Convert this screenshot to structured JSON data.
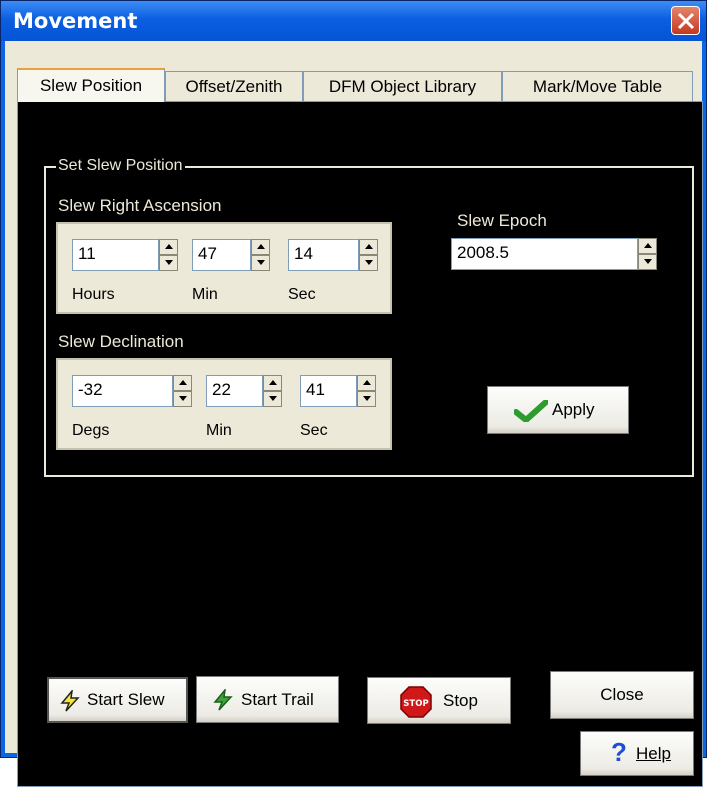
{
  "window": {
    "title": "Movement"
  },
  "tabs": [
    {
      "label": "Slew Position",
      "active": true
    },
    {
      "label": "Offset/Zenith",
      "active": false
    },
    {
      "label": "DFM Object Library",
      "active": false
    },
    {
      "label": "Mark/Move Table",
      "active": false
    }
  ],
  "slew": {
    "group_title": "Set Slew Position",
    "ra": {
      "label": "Slew Right Ascension",
      "hours": {
        "value": "11",
        "unit": "Hours"
      },
      "min": {
        "value": "47",
        "unit": "Min"
      },
      "sec": {
        "value": "14",
        "unit": "Sec"
      }
    },
    "dec": {
      "label": "Slew Declination",
      "degs": {
        "value": "-32",
        "unit": "Degs"
      },
      "min": {
        "value": "22",
        "unit": "Min"
      },
      "sec": {
        "value": "41",
        "unit": "Sec"
      }
    },
    "epoch": {
      "label": "Slew Epoch",
      "value": "2008.5"
    },
    "apply_label": "Apply"
  },
  "buttons": {
    "start_slew": "Start Slew",
    "start_trail": "Start Trail",
    "stop": "Stop",
    "stop_sign": "STOP",
    "close": "Close",
    "help": "Help"
  },
  "colors": {
    "titlebar": "#0a5fe0",
    "panel": "#000000",
    "face": "#ece9d8",
    "check_green": "#2d9b2d",
    "stop_red": "#d01818",
    "help_blue": "#1c4fd6"
  }
}
